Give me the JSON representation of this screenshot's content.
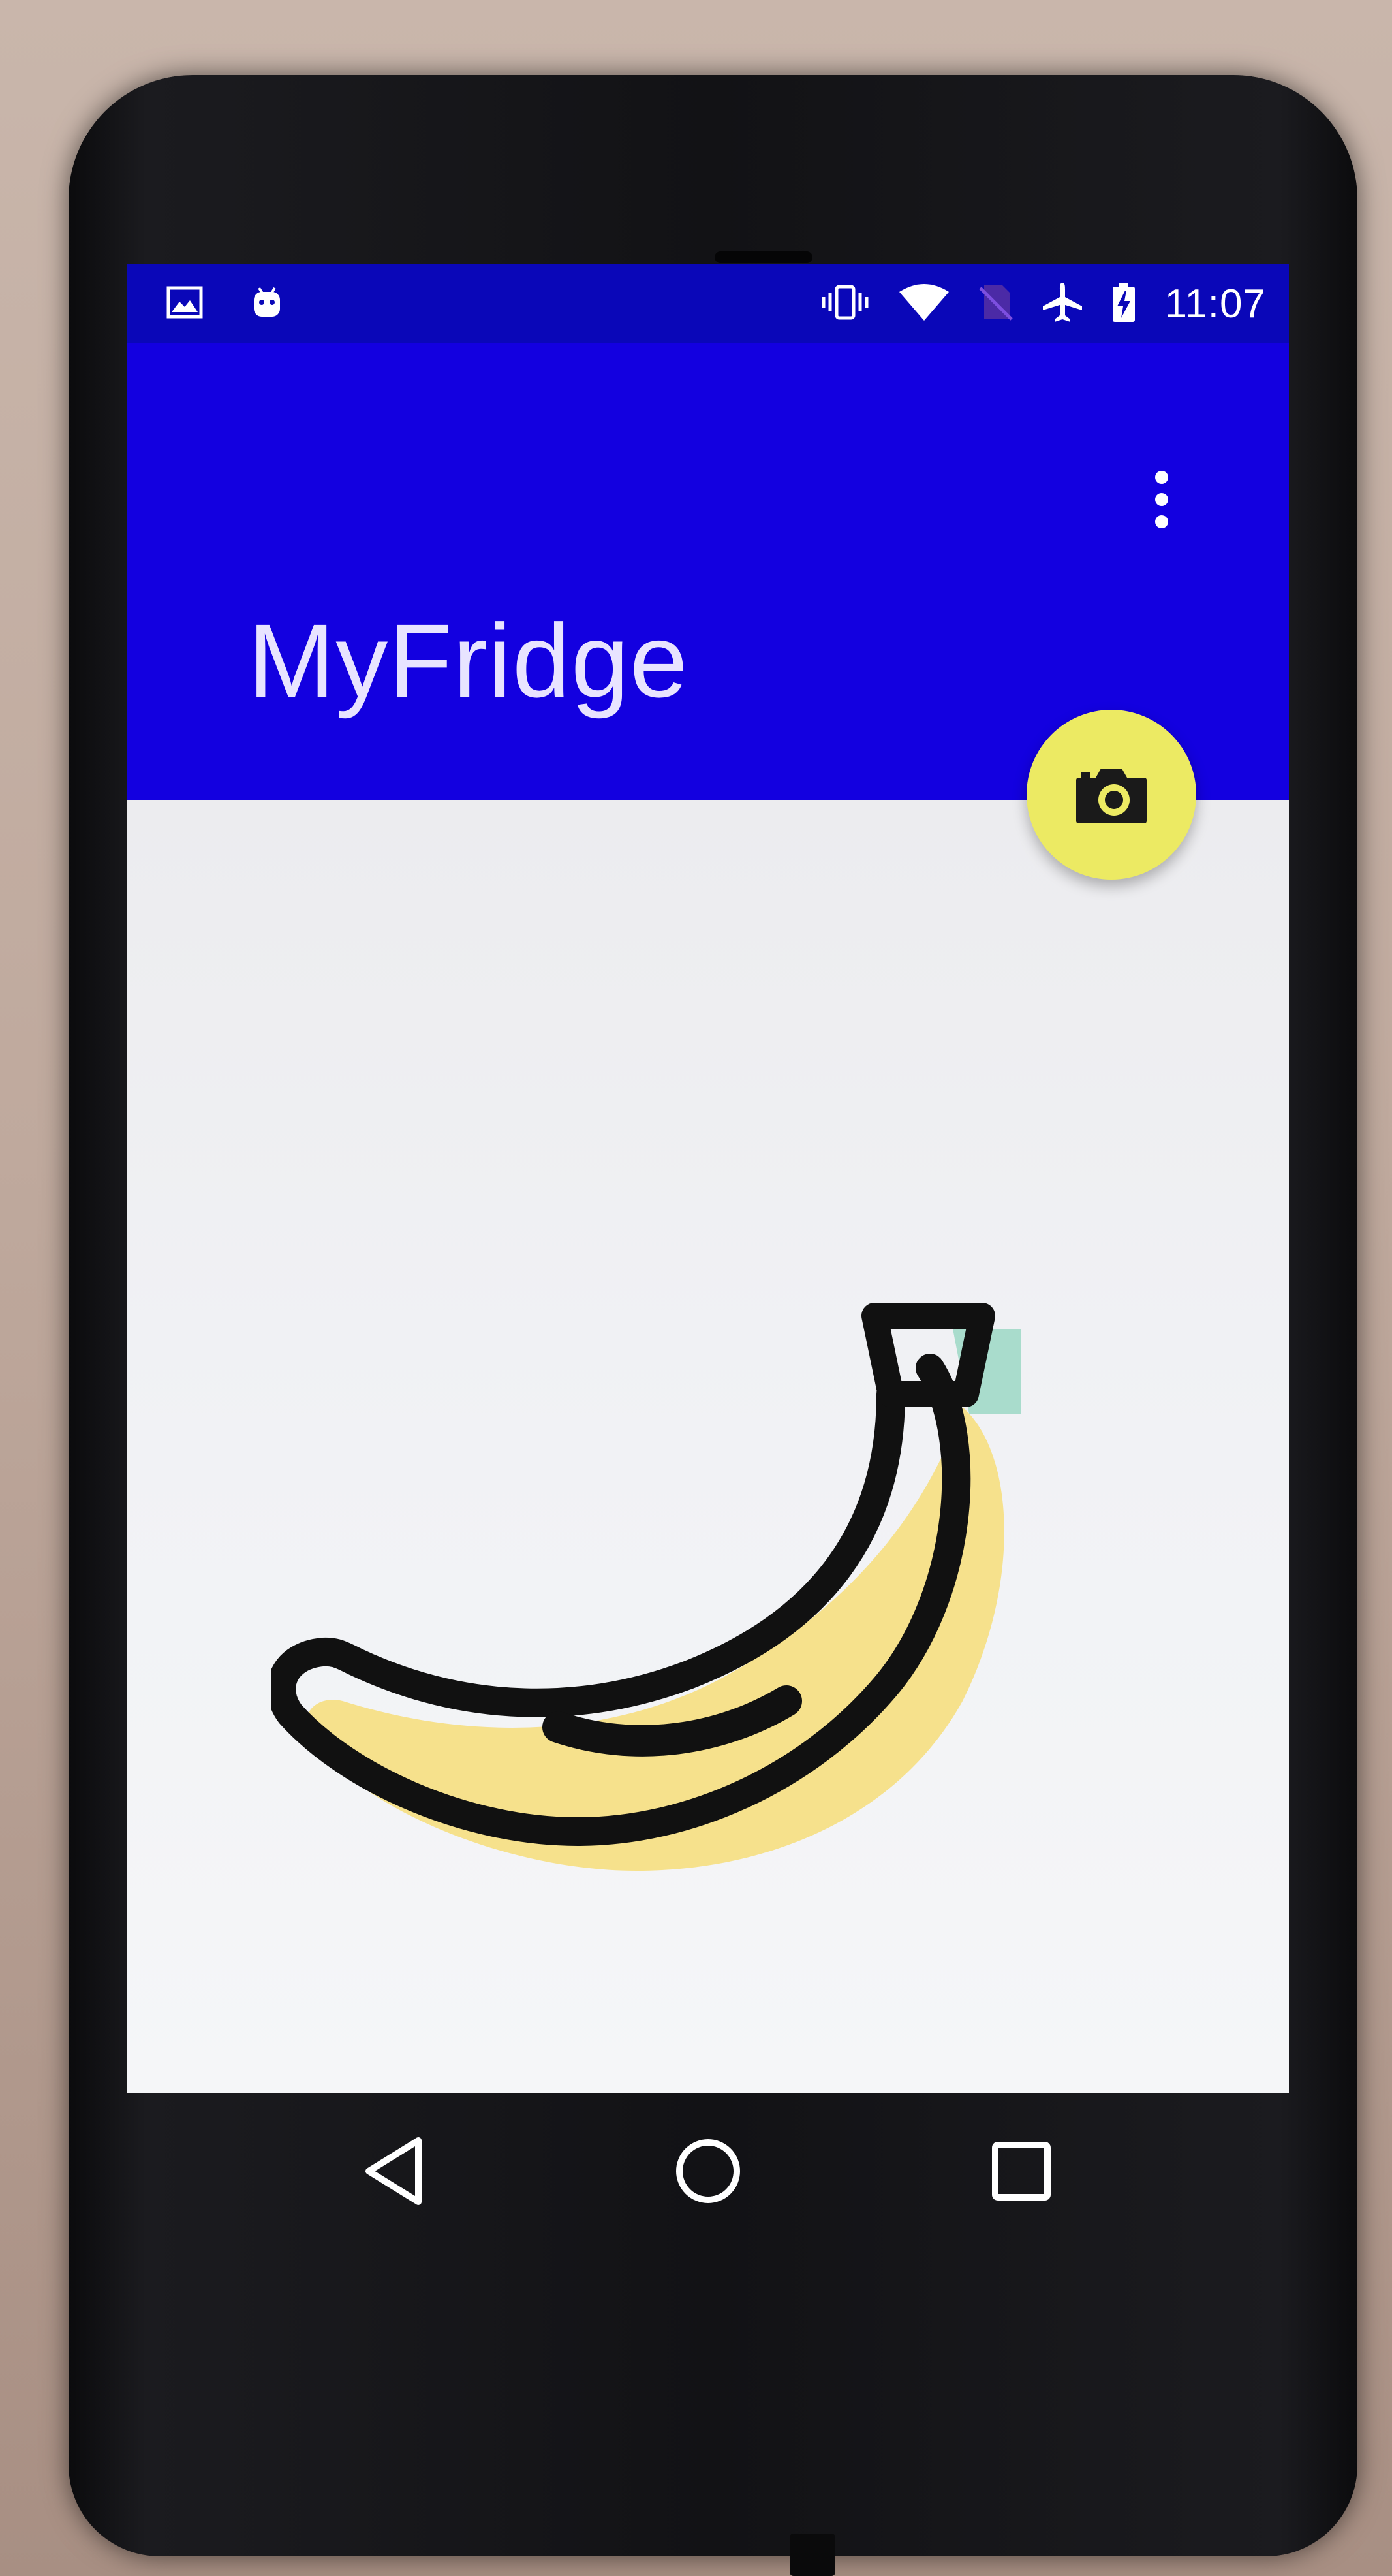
{
  "app": {
    "title": "MyFridge"
  },
  "status_bar": {
    "time": "11:07",
    "left_icons": [
      "image-notification-icon",
      "android-notification-icon"
    ],
    "right_icons": [
      "vibrate-icon",
      "wifi-icon",
      "no-sim-icon",
      "airplane-mode-icon",
      "battery-charging-icon"
    ]
  },
  "fab": {
    "icon": "camera-icon",
    "color": "#ecea63"
  },
  "content": {
    "image": "banana-icon"
  },
  "navigation": {
    "buttons": [
      "back-icon",
      "home-icon",
      "recents-icon"
    ]
  },
  "colors": {
    "status_bar": "#0a07b8",
    "app_bar": "#1300e0",
    "title_text": "#e8e4ff",
    "banana_fill": "#f6e18c",
    "banana_stem": "#a9dccc",
    "outline": "#111111"
  }
}
